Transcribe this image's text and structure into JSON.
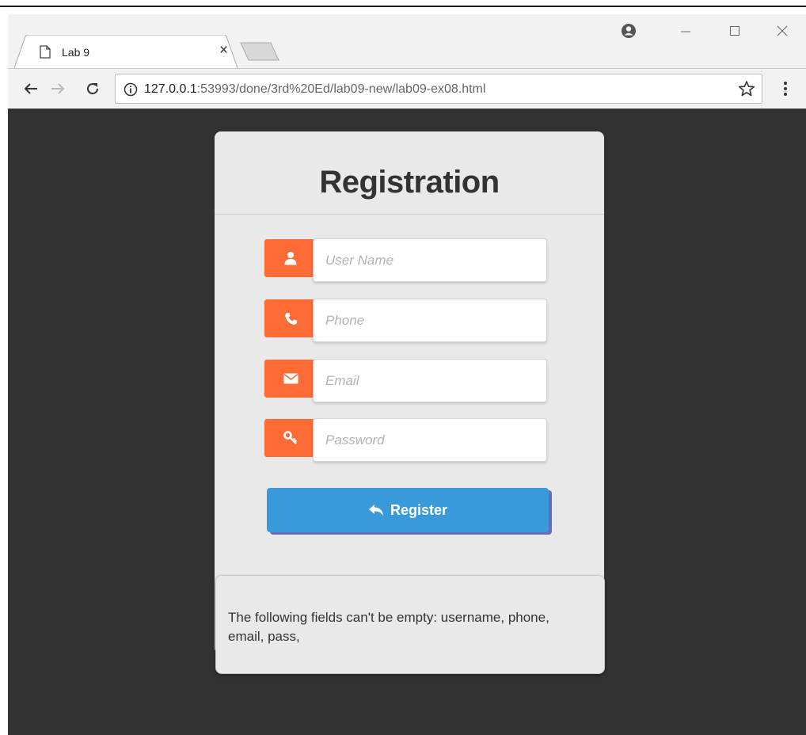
{
  "browser": {
    "tab_title": "Lab 9",
    "tab_close": "×",
    "url_host": "127.0.0.1",
    "url_rest": ":53993/done/3rd%20Ed/lab09-new/lab09-ex08.html"
  },
  "form": {
    "title": "Registration",
    "fields": [
      {
        "placeholder": "User Name",
        "value": "",
        "icon": "user-icon"
      },
      {
        "placeholder": "Phone",
        "value": "",
        "icon": "phone-icon"
      },
      {
        "placeholder": "Email",
        "value": "",
        "icon": "envelope-icon"
      },
      {
        "placeholder": "Password",
        "value": "",
        "icon": "key-icon"
      }
    ],
    "register_label": "Register"
  },
  "message": {
    "text": "The following fields can't be empty: username, phone, email, pass,"
  },
  "colors": {
    "accent": "#ff6b35",
    "button": "#3a9ad9",
    "background": "#323232",
    "card": "#e9e9e9"
  }
}
